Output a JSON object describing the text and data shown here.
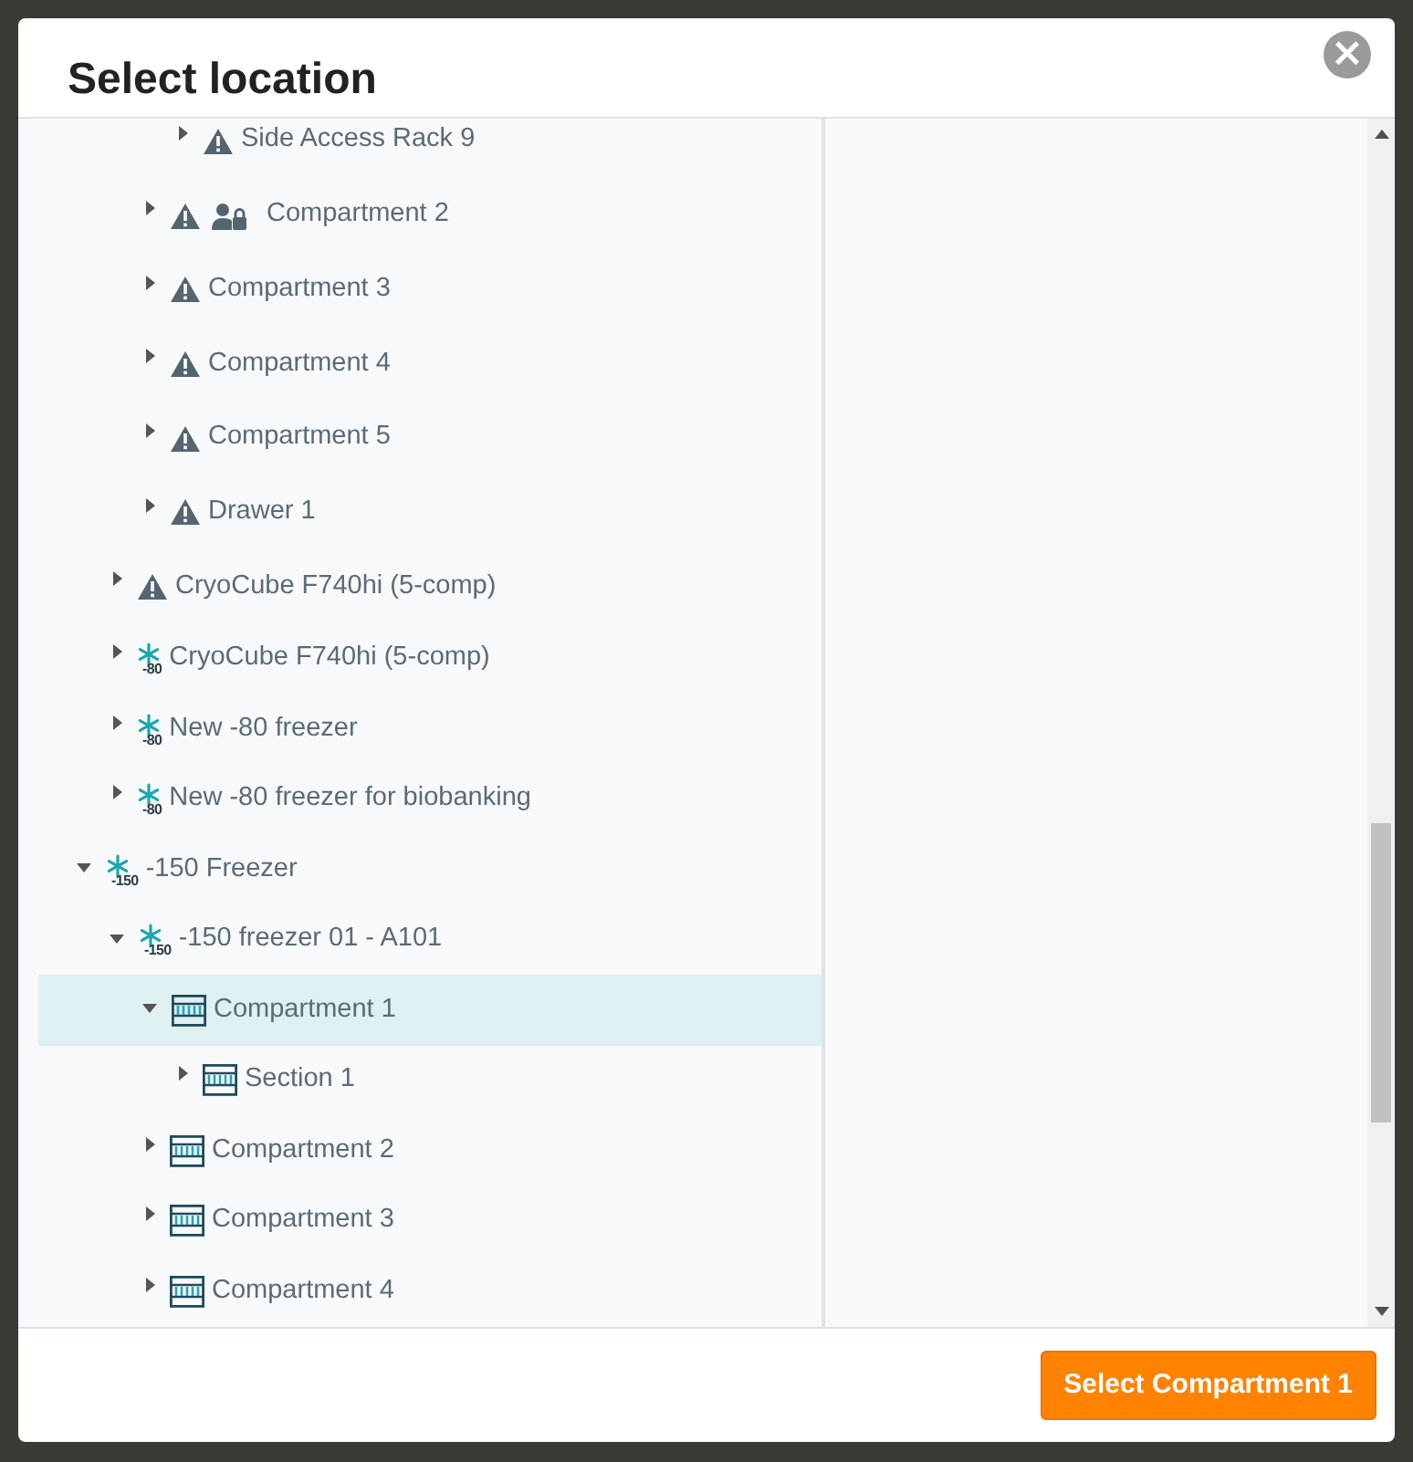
{
  "dialog": {
    "title": "Select location",
    "close_label": "×"
  },
  "tree": [
    {
      "children": [
        {
          "children": [
            {
              "children": [
                {
                  "label": "Side Access Rack 9",
                  "kind": "warning",
                  "expanded": false,
                  "selected": false
                }
              ]
            },
            {
              "label": "Compartment 2",
              "kind": "warning-locked",
              "expanded": false,
              "selected": false
            },
            {
              "label": "Compartment 3",
              "kind": "warning",
              "expanded": false,
              "selected": false
            },
            {
              "label": "Compartment 4",
              "kind": "warning",
              "expanded": false,
              "selected": false
            },
            {
              "label": "Compartment 5",
              "kind": "warning",
              "expanded": false,
              "selected": false
            },
            {
              "label": "Drawer 1",
              "kind": "warning",
              "expanded": false,
              "selected": false
            }
          ]
        },
        {
          "label": "CryoCube F740hi (5-comp)",
          "kind": "warning",
          "expanded": false,
          "selected": false
        },
        {
          "label": "CryoCube F740hi (5-comp)",
          "kind": "freezer",
          "temp": "-80",
          "expanded": false,
          "selected": false
        },
        {
          "label": "New -80 freezer",
          "kind": "freezer",
          "temp": "-80",
          "expanded": false,
          "selected": false
        },
        {
          "label": "New -80 freezer for biobanking",
          "kind": "freezer",
          "temp": "-80",
          "expanded": false,
          "selected": false
        }
      ]
    },
    {
      "label": "-150 Freezer",
      "kind": "freezer",
      "temp": "-150",
      "expanded": true,
      "selected": false,
      "children": [
        {
          "label": "-150 freezer 01 - A101",
          "kind": "freezer",
          "temp": "-150",
          "expanded": true,
          "selected": false,
          "children": [
            {
              "label": "Compartment 1",
              "kind": "rack",
              "expanded": true,
              "selected": true,
              "children": [
                {
                  "label": "Section 1",
                  "kind": "rack",
                  "expanded": false,
                  "selected": false
                }
              ]
            },
            {
              "label": "Compartment 2",
              "kind": "rack",
              "expanded": false,
              "selected": false
            },
            {
              "label": "Compartment 3",
              "kind": "rack",
              "expanded": false,
              "selected": false
            },
            {
              "label": "Compartment 4",
              "kind": "rack",
              "expanded": false,
              "selected": false
            }
          ]
        }
      ]
    }
  ],
  "select_button": "Select Compartment 1"
}
